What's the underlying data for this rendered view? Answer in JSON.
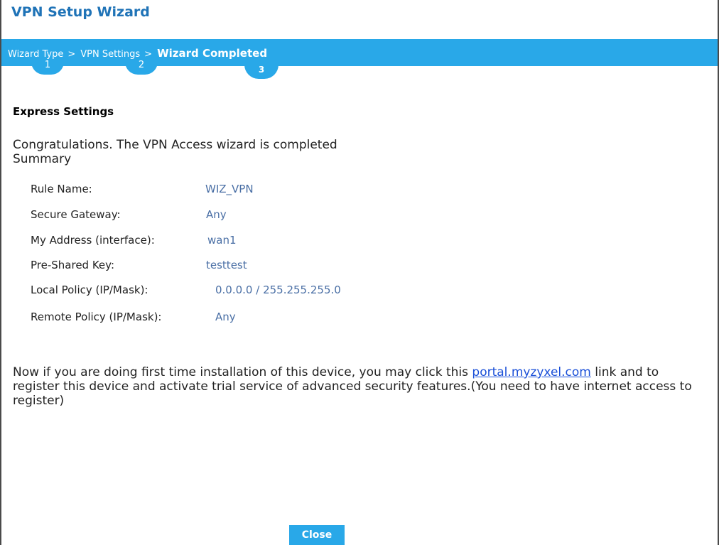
{
  "window": {
    "title": "VPN Setup Wizard"
  },
  "steps": [
    {
      "label": "Wizard Type",
      "number": "1"
    },
    {
      "label": "VPN Settings",
      "number": "2"
    },
    {
      "label": "Wizard Completed",
      "number": "3"
    }
  ],
  "breadcrumb_separator": ">",
  "content": {
    "section_title": "Express Settings",
    "congrats": "Congratulations. The VPN Access wizard is completed",
    "summary_label": "Summary",
    "summary": [
      {
        "label": "Rule Name:",
        "value": "WIZ_VPN"
      },
      {
        "label": "Secure Gateway:",
        "value": "Any"
      },
      {
        "label": "My Address (interface):",
        "value": "wan1"
      },
      {
        "label": "Pre-Shared Key:",
        "value": "testtest"
      },
      {
        "label": "Local Policy (IP/Mask):",
        "value": "0.0.0.0 / 255.255.255.0"
      },
      {
        "label": "Remote Policy (IP/Mask):",
        "value": "Any"
      }
    ],
    "note_before": "Now if you are doing first time installation of this device, you may click this ",
    "note_link": "portal.myzyxel.com",
    "note_after": " link and to register this device and activate trial service of advanced security features.(You need to have internet access to register)"
  },
  "buttons": {
    "close": "Close"
  },
  "colors": {
    "accent": "#29a8e8",
    "title": "#1f73b7",
    "value": "#4a6fa5",
    "link": "#1a4fd8"
  }
}
